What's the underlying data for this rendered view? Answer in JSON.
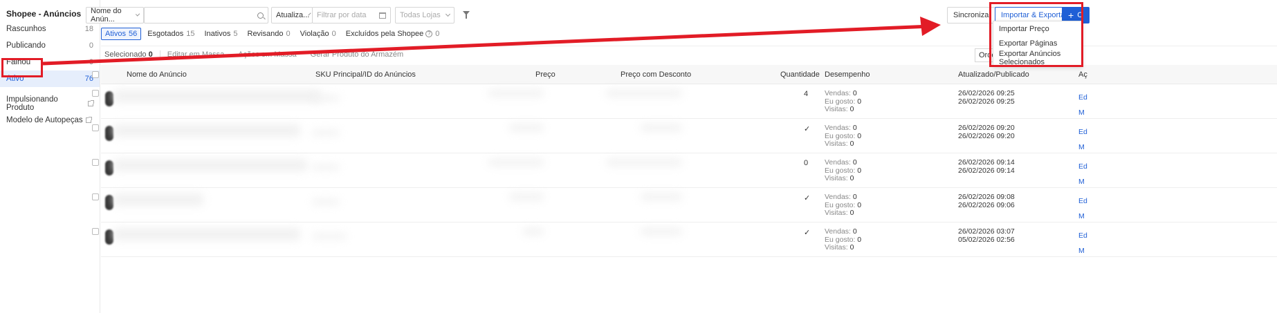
{
  "sidebar": {
    "title": "Shopee - Anúncios",
    "items": [
      {
        "label": "Rascunhos",
        "count": "18"
      },
      {
        "label": "Publicando",
        "count": "0"
      },
      {
        "label": "Falhou",
        "count": "0"
      },
      {
        "label": "Ativo",
        "count": "76"
      }
    ],
    "links": [
      {
        "label": "Impulsionando Produto"
      },
      {
        "label": "Modelo de Autopeças"
      }
    ]
  },
  "filters": {
    "name_select": "Nome do Anún...",
    "search_placeholder": "",
    "date_select": "Atualiza...",
    "date_placeholder": "Filtrar por data",
    "store_placeholder": "Todas Lojas"
  },
  "toolbar": {
    "sync_label": "Sincronizar",
    "import_export_label": "Importar & Exportar",
    "create_label": "C"
  },
  "dropdown": {
    "items": [
      "Importar Preço",
      "Exportar Páginas",
      "Exportar Anúncios Selecionados"
    ]
  },
  "tabs": [
    {
      "label": "Ativos",
      "count": "56"
    },
    {
      "label": "Esgotados",
      "count": "15"
    },
    {
      "label": "Inativos",
      "count": "5"
    },
    {
      "label": "Revisando",
      "count": "0"
    },
    {
      "label": "Violação",
      "count": "0"
    },
    {
      "label": "Excluídos pela Shopee",
      "count": "0"
    }
  ],
  "actions": {
    "selected_label": "Selecionado",
    "selected_count": "0",
    "edit_bulk": "Editar em Massa",
    "bulk_actions": "Ações em Massa",
    "warehouse": "Gerar Produto do Armazém",
    "sort": "Orden"
  },
  "table": {
    "headers": {
      "name": "Nome do Anúncio",
      "sku": "SKU Principal/ID do Anúncios",
      "price": "Preço",
      "discount": "Preço com Desconto",
      "qty": "Quantidade",
      "perf": "Desempenho",
      "updated": "Atualizado/Publicado",
      "actions": "Aç"
    },
    "perf_labels": {
      "sales": "Vendas:",
      "likes": "Eu gosto:",
      "visits": "Visitas:"
    },
    "rows": [
      {
        "qty": "4",
        "sales": "0",
        "likes": "0",
        "visits": "0",
        "updated": "26/02/2026 09:25",
        "published": "26/02/2026 09:25",
        "a1": "Ed",
        "a2": "M"
      },
      {
        "qty": "✓",
        "sales": "0",
        "likes": "0",
        "visits": "0",
        "updated": "26/02/2026 09:20",
        "published": "26/02/2026 09:20",
        "a1": "Ed",
        "a2": "M"
      },
      {
        "qty": "0",
        "sales": "0",
        "likes": "0",
        "visits": "0",
        "updated": "26/02/2026 09:14",
        "published": "26/02/2026 09:14",
        "a1": "Ed",
        "a2": "M"
      },
      {
        "qty": "✓",
        "sales": "0",
        "likes": "0",
        "visits": "0",
        "updated": "26/02/2026 09:08",
        "published": "26/02/2026 09:06",
        "a1": "Ed",
        "a2": "M"
      },
      {
        "qty": "✓",
        "sales": "0",
        "likes": "0",
        "visits": "0",
        "updated": "26/02/2026 03:07",
        "published": "05/02/2026 02:56",
        "a1": "Ed",
        "a2": "M"
      }
    ]
  },
  "colors": {
    "accent": "#1f5fd6",
    "annotation": "#e21c26"
  }
}
